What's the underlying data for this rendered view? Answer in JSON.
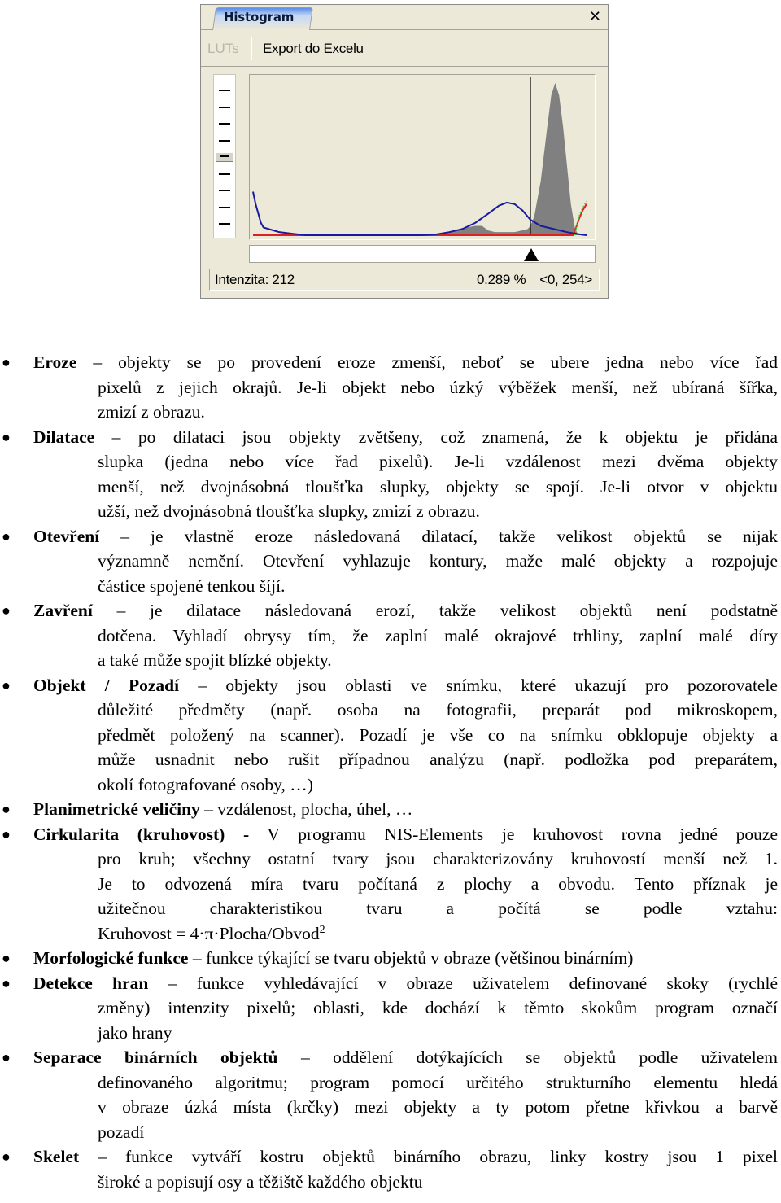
{
  "histogram_window": {
    "tab_label": "Histogram",
    "close_icon": "close-icon",
    "toolbar": {
      "luts_label": "LUTs",
      "luts_enabled": false,
      "export_label": "Export do Excelu"
    },
    "zoom_slider": {
      "tick_count": 9,
      "thumb_position_index": 4
    },
    "status": {
      "intensity_label": "Intenzita: 212",
      "percent": "0.289 %",
      "range": "<0, 254>"
    },
    "colors": {
      "window_bg": "#ece9d8",
      "histogram_fill": "#808080",
      "cumulative_line": "#1a1aa0",
      "red_line": "#e02020",
      "green_line": "#30d030",
      "cursor_line": "#000000"
    }
  },
  "chart_data": {
    "type": "area",
    "title": "Histogram",
    "x_range": [
      0,
      255
    ],
    "cursor_intensity": 212,
    "marker_intensity": 212,
    "series": [
      {
        "name": "histogram (gray fill)",
        "x": [
          0,
          128,
          140,
          150,
          160,
          170,
          175,
          180,
          185,
          190,
          200,
          210,
          212,
          215,
          220,
          225,
          228,
          231,
          234,
          237,
          240,
          243,
          246,
          248,
          250,
          252,
          255
        ],
        "values": [
          0,
          0,
          0.005,
          0.02,
          0.045,
          0.06,
          0.06,
          0.03,
          0.02,
          0.02,
          0.02,
          0.04,
          0.06,
          0.12,
          0.35,
          0.7,
          0.9,
          0.98,
          0.9,
          0.7,
          0.45,
          0.2,
          0.05,
          0.01,
          0.0,
          0.0,
          0.0
        ]
      },
      {
        "name": "blue curve",
        "x": [
          0,
          2,
          4,
          6,
          8,
          12,
          16,
          20,
          30,
          40,
          128,
          140,
          150,
          160,
          170,
          180,
          188,
          194,
          200,
          206,
          212,
          220,
          230,
          240,
          250,
          255
        ],
        "values": [
          0.28,
          0.2,
          0.14,
          0.08,
          0.05,
          0.04,
          0.03,
          0.02,
          0.01,
          0.0,
          0.0,
          0.005,
          0.02,
          0.04,
          0.08,
          0.14,
          0.19,
          0.21,
          0.2,
          0.16,
          0.1,
          0.06,
          0.04,
          0.02,
          0.005,
          0.0
        ]
      },
      {
        "name": "red curve",
        "x": [
          0,
          245,
          247,
          249,
          252,
          255
        ],
        "values": [
          0,
          0,
          0.05,
          0.1,
          0.16,
          0.2
        ]
      },
      {
        "name": "green curve",
        "x": [
          0,
          246,
          248,
          250,
          253,
          255
        ],
        "values": [
          0,
          0,
          0.08,
          0.14,
          0.19,
          0.22
        ]
      }
    ],
    "ylim": [
      0,
      1
    ],
    "grid": false,
    "legend": "none"
  },
  "glossary": [
    {
      "term": "Eroze",
      "sep": " – ",
      "first": "objekty se po provedení eroze zmenší, neboť se ubere jedna nebo více řad",
      "rest": [
        "pixelů z jejich okrajů. Je-li objekt nebo úzký výběžek menší, než ubíraná šířka,",
        "zmizí z obrazu."
      ]
    },
    {
      "term": "Dilatace",
      "sep": " – ",
      "first": "po dilataci jsou objekty zvětšeny, což znamená, že k objektu je přidána",
      "rest": [
        "slupka (jedna nebo více řad pixelů). Je-li vzdálenost mezi dvěma objekty",
        "menší, než dvojnásobná tloušťka slupky, objekty se spojí. Je-li otvor v objektu",
        "užší, než dvojnásobná tloušťka slupky, zmizí z obrazu."
      ]
    },
    {
      "term": "Otevření",
      "sep": " – ",
      "first": "je vlastně eroze následovaná dilatací, takže velikost objektů se nijak",
      "rest": [
        "významně nemění. Otevření vyhlazuje kontury, maže malé objekty a rozpojuje",
        "částice spojené tenkou šíjí."
      ]
    },
    {
      "term": "Zavření",
      "sep": " – ",
      "first": "je dilatace následovaná erozí, takže velikost objektů není podstatně",
      "rest": [
        "dotčena. Vyhladí obrysy tím, že zaplní malé okrajové trhliny, zaplní malé díry",
        "a také může spojit blízké objekty."
      ]
    },
    {
      "term": "Objekt / Pozadí",
      "sep": " – ",
      "first": "objekty jsou oblasti ve snímku, které ukazují pro pozorovatele",
      "rest": [
        "důležité předměty (např. osoba na fotografii, preparát pod mikroskopem,",
        "předmět položený na scanner). Pozadí je vše co na snímku obklopuje objekty a",
        "může usnadnit nebo rušit případnou analýzu (např. podložka pod preparátem,",
        "okolí fotografované osoby, …)"
      ]
    },
    {
      "term": "Planimetrické veličiny",
      "sep": " – ",
      "first": "vzdálenost, plocha, úhel, …",
      "rest": []
    },
    {
      "term": "Cirkularita (kruhovost) -",
      "sep": " ",
      "first": "V programu NIS-Elements je kruhovost rovna jedné pouze",
      "rest": [
        "pro kruh; všechny ostatní tvary jsou charakterizovány kruhovostí menší než 1.",
        "Je to odvozená míra tvaru počítaná z plochy a obvodu. Tento příznak je",
        "užitečnou charakteristikou tvaru a počítá se podle vztahu:"
      ],
      "formula": "Kruhovost = 4·π·Plocha/Obvod",
      "formula_sup": "2"
    },
    {
      "term": "Morfologické funkce",
      "sep": " – ",
      "first": "funkce týkající se tvaru objektů v obraze (většinou binárním)",
      "rest": []
    },
    {
      "term": "Detekce hran",
      "sep": " – ",
      "first": "funkce vyhledávající v obraze uživatelem definované skoky (rychlé",
      "rest": [
        "změny) intenzity pixelů; oblasti, kde dochází k těmto skokům program označí",
        "jako hrany"
      ]
    },
    {
      "term": "Separace binárních objektů",
      "sep": " – ",
      "first": "oddělení dotýkajících se objektů podle uživatelem",
      "rest": [
        "definovaného algoritmu; program pomocí určitého strukturního elementu hledá",
        "v obraze úzká místa (krčky) mezi objekty a ty potom přetne křivkou a barvě",
        "pozadí"
      ]
    },
    {
      "term": "Skelet",
      "sep": " – ",
      "first": "funkce vytváří kostru objektů binárního obrazu, linky kostry jsou 1 pixel",
      "rest": [
        "široké a popisují osy a těžiště každého objektu"
      ]
    }
  ]
}
